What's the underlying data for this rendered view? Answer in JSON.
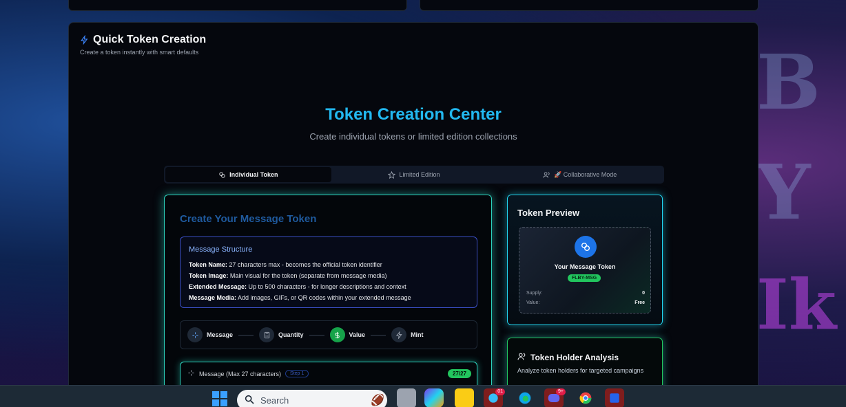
{
  "quick": {
    "title": "Quick Token Creation",
    "subtitle": "Create a token instantly with smart defaults"
  },
  "center": {
    "title": "Token Creation Center",
    "subtitle": "Create individual tokens or limited edition collections"
  },
  "tabs": [
    {
      "label": "Individual Token",
      "icon": "link-icon",
      "active": true
    },
    {
      "label": "Limited Edition",
      "icon": "star-icon",
      "active": false
    },
    {
      "label": "🚀 Collaborative Mode",
      "icon": "users-icon",
      "active": false
    }
  ],
  "create": {
    "title": "Create Your Message Token",
    "structure_title": "Message Structure",
    "structure": [
      {
        "label": "Token Name:",
        "text": " 27 characters max - becomes the official token identifier"
      },
      {
        "label": "Token Image:",
        "text": " Main visual for the token (separate from message media)"
      },
      {
        "label": "Extended Message:",
        "text": " Up to 500 characters - for longer descriptions and context"
      },
      {
        "label": "Message Media:",
        "text": " Add images, GIFs, or QR codes within your extended message"
      }
    ],
    "steps": [
      "Message",
      "Quantity",
      "Value",
      "Mint"
    ],
    "message_label": "Message (Max 27 characters)",
    "step_pill": "Step 1",
    "count": "27/27"
  },
  "preview": {
    "title": "Token Preview",
    "name": "Your Message Token",
    "symbol": "FLBY-MSG",
    "supply_label": "Supply:",
    "supply_value": "0",
    "value_label": "Value:",
    "value_value": "Free"
  },
  "holder": {
    "title": "Token Holder Analysis",
    "subtitle": "Analyze token holders for targeted campaigns"
  },
  "taskbar": {
    "search_placeholder": "Search",
    "telegram_badge": "01",
    "discord_badge": "9+"
  },
  "colors": {
    "accent": "#22b8f0",
    "glow": "#2dd4bf",
    "success": "#22c55e"
  }
}
